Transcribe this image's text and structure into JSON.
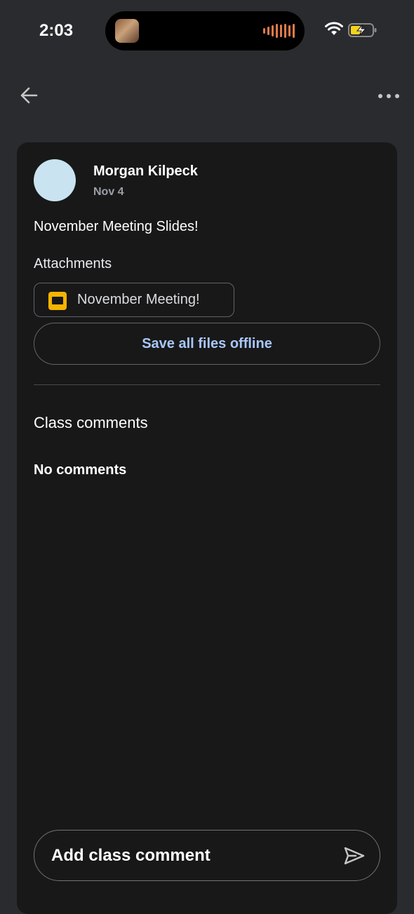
{
  "status_bar": {
    "time": "2:03"
  },
  "post": {
    "author": "Morgan Kilpeck",
    "date": "Nov 4",
    "title": "November Meeting Slides!",
    "attachments_label": "Attachments",
    "attachments": [
      {
        "name": "November Meeting!",
        "icon": "google-slides-icon"
      }
    ],
    "save_offline_label": "Save all files offline"
  },
  "comments": {
    "heading": "Class comments",
    "empty_text": "No comments",
    "input_placeholder": "Add class comment"
  },
  "colors": {
    "background": "#2a2b2e",
    "card": "#181818",
    "accent": "#a8c7fa",
    "avatar": "#c9e3f1",
    "slides_yellow": "#f6b400"
  }
}
